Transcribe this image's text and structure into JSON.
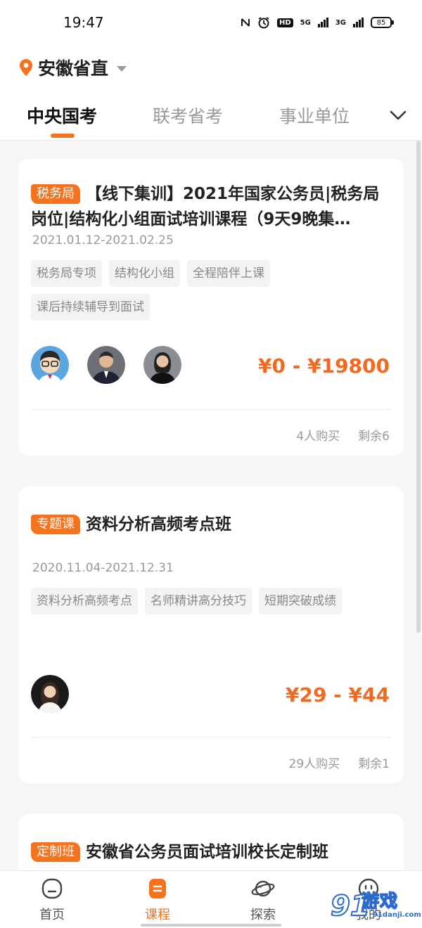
{
  "status_bar": {
    "time": "19:47",
    "network_5g": "5G",
    "network_3g": "3G",
    "hd_label": "HD",
    "battery": "85"
  },
  "header": {
    "location": "安徽省直",
    "tabs": [
      {
        "label": "中央国考",
        "active": true
      },
      {
        "label": "联考省考",
        "active": false
      },
      {
        "label": "事业单位",
        "active": false
      }
    ]
  },
  "courses": [
    {
      "badge": "税务局",
      "title": "【线下集训】2021年国家公务员|税务局岗位|结构化小组面试培训课程（9天9晚集…",
      "date": "2021.01.12-2021.02.25",
      "tags": [
        "税务局专项",
        "结构化小组",
        "全程陪伴上课",
        "课后持续辅导到面试"
      ],
      "price": "¥0 - ¥19800",
      "sold": "4人购买",
      "remaining": "剩余6"
    },
    {
      "badge": "专题课",
      "title": "资料分析高频考点班",
      "date": "2020.11.04-2021.12.31",
      "tags": [
        "资料分析高频考点",
        "名师精讲高分技巧",
        "短期突破成绩"
      ],
      "price": "¥29 - ¥44",
      "sold": "29人购买",
      "remaining": "剩余1"
    },
    {
      "badge": "定制班",
      "title": "安徽省公务员面试培训校长定制班"
    }
  ],
  "bottom_nav": [
    {
      "label": "首页",
      "icon": "home-icon",
      "active": false
    },
    {
      "label": "课程",
      "icon": "course-icon",
      "active": true
    },
    {
      "label": "探索",
      "icon": "planet-icon",
      "active": false
    },
    {
      "label": "我的",
      "icon": "profile-icon",
      "active": false
    }
  ],
  "watermark": {
    "text": "游戏",
    "brand_num": "91",
    "url": "91danji.com"
  },
  "colors": {
    "accent": "#f5731f",
    "price": "#f26a21",
    "watermark": "#2b6bd1"
  }
}
